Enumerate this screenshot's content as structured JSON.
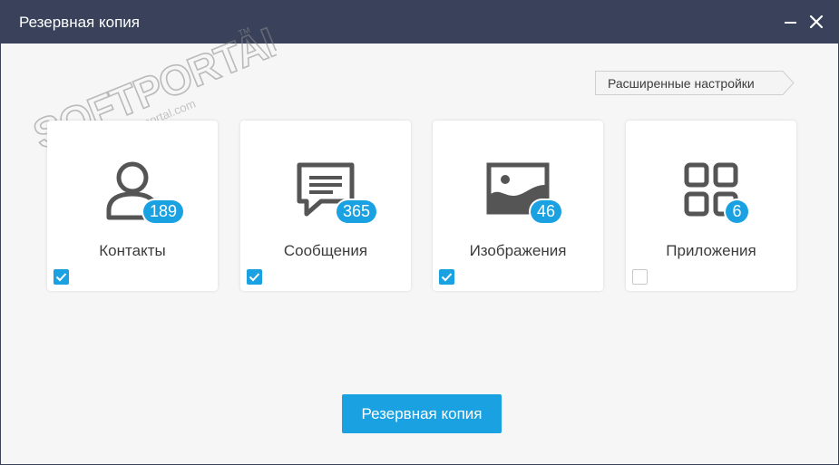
{
  "window": {
    "title": "Резервная копия"
  },
  "watermark": {
    "brand": "SOFTPORTAL",
    "url": "www.softportal.com",
    "tm": "TM"
  },
  "advanced_settings": {
    "label": "Расширенные настройки"
  },
  "cards": [
    {
      "label": "Контакты",
      "count": "189",
      "icon": "person-icon",
      "checked": true
    },
    {
      "label": "Сообщения",
      "count": "365",
      "icon": "message-icon",
      "checked": true
    },
    {
      "label": "Изображения",
      "count": "46",
      "icon": "image-icon",
      "checked": true
    },
    {
      "label": "Приложения",
      "count": "6",
      "icon": "apps-grid-icon",
      "checked": false
    }
  ],
  "primary_button": {
    "label": "Резервная копия"
  },
  "colors": {
    "titlebar": "#39425a",
    "accent": "#1aa1e1",
    "background": "#f6f6f6",
    "icon": "#555555"
  }
}
